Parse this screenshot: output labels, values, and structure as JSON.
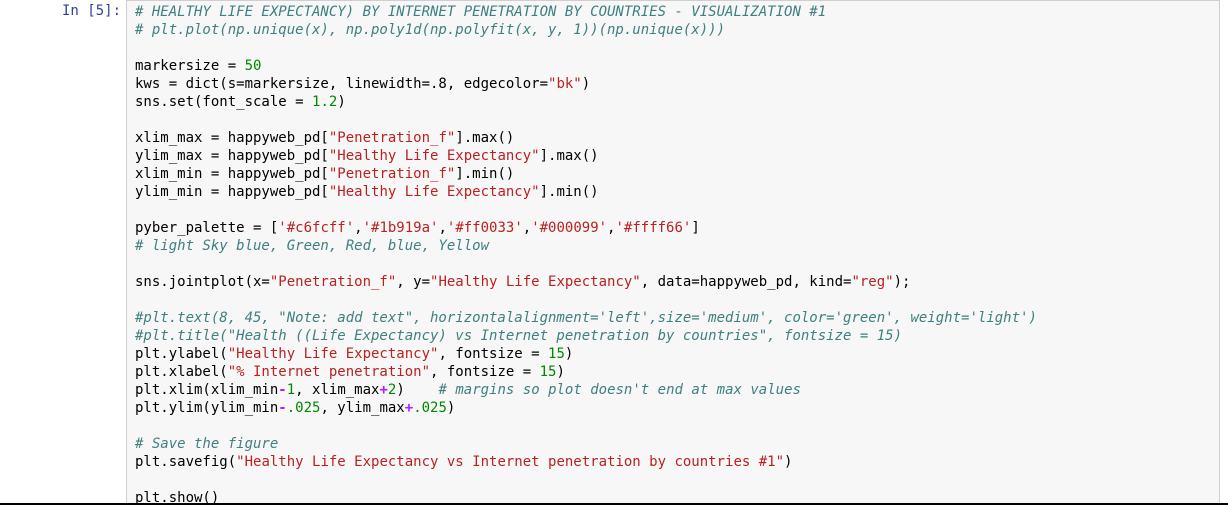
{
  "cell": {
    "prompt": "In [5]:",
    "lines": [
      [
        {
          "t": "c",
          "v": "# HEALTHY LIFE EXPECTANCY) BY INTERNET PENETRATION BY COUNTRIES - VISUALIZATION #1"
        }
      ],
      [
        {
          "t": "c",
          "v": "# plt.plot(np.unique(x), np.poly1d(np.polyfit(x, y, 1))(np.unique(x)))"
        }
      ],
      [],
      [
        {
          "t": "p",
          "v": "markersize = "
        },
        {
          "t": "n",
          "v": "50"
        }
      ],
      [
        {
          "t": "p",
          "v": "kws = dict(s=markersize, linewidth=.8, edgecolor="
        },
        {
          "t": "s",
          "v": "\"bk\""
        },
        {
          "t": "p",
          "v": ")"
        }
      ],
      [
        {
          "t": "p",
          "v": "sns.set(font_scale = "
        },
        {
          "t": "n",
          "v": "1.2"
        },
        {
          "t": "p",
          "v": ")"
        }
      ],
      [],
      [
        {
          "t": "p",
          "v": "xlim_max = happyweb_pd["
        },
        {
          "t": "s",
          "v": "\"Penetration_f\""
        },
        {
          "t": "p",
          "v": "].max()"
        }
      ],
      [
        {
          "t": "p",
          "v": "ylim_max = happyweb_pd["
        },
        {
          "t": "s",
          "v": "\"Healthy Life Expectancy\""
        },
        {
          "t": "p",
          "v": "].max()"
        }
      ],
      [
        {
          "t": "p",
          "v": "xlim_min = happyweb_pd["
        },
        {
          "t": "s",
          "v": "\"Penetration_f\""
        },
        {
          "t": "p",
          "v": "].min()"
        }
      ],
      [
        {
          "t": "p",
          "v": "ylim_min = happyweb_pd["
        },
        {
          "t": "s",
          "v": "\"Healthy Life Expectancy\""
        },
        {
          "t": "p",
          "v": "].min()"
        }
      ],
      [],
      [
        {
          "t": "p",
          "v": "pyber_palette = ["
        },
        {
          "t": "s",
          "v": "'#c6fcff'"
        },
        {
          "t": "p",
          "v": ","
        },
        {
          "t": "s",
          "v": "'#1b919a'"
        },
        {
          "t": "p",
          "v": ","
        },
        {
          "t": "s",
          "v": "'#ff0033'"
        },
        {
          "t": "p",
          "v": ","
        },
        {
          "t": "s",
          "v": "'#000099'"
        },
        {
          "t": "p",
          "v": ","
        },
        {
          "t": "s",
          "v": "'#ffff66'"
        },
        {
          "t": "p",
          "v": "]"
        }
      ],
      [
        {
          "t": "c",
          "v": "# light Sky blue, Green, Red, blue, Yellow"
        }
      ],
      [],
      [
        {
          "t": "p",
          "v": "sns.jointplot(x="
        },
        {
          "t": "s",
          "v": "\"Penetration_f\""
        },
        {
          "t": "p",
          "v": ", y="
        },
        {
          "t": "s",
          "v": "\"Healthy Life Expectancy\""
        },
        {
          "t": "p",
          "v": ", data=happyweb_pd, kind="
        },
        {
          "t": "s",
          "v": "\"reg\""
        },
        {
          "t": "p",
          "v": ");"
        }
      ],
      [],
      [
        {
          "t": "c",
          "v": "#plt.text(8, 45, \"Note: add text\", horizontalalignment='left',size='medium', color='green', weight='light')"
        }
      ],
      [
        {
          "t": "c",
          "v": "#plt.title(\"Health ((Life Expectancy) vs Internet penetration by countries\", fontsize = 15)"
        }
      ],
      [
        {
          "t": "p",
          "v": "plt.ylabel("
        },
        {
          "t": "s",
          "v": "\"Healthy Life Expectancy\""
        },
        {
          "t": "p",
          "v": ", fontsize = "
        },
        {
          "t": "n",
          "v": "15"
        },
        {
          "t": "p",
          "v": ")"
        }
      ],
      [
        {
          "t": "p",
          "v": "plt.xlabel("
        },
        {
          "t": "s",
          "v": "\"% Internet penetration\""
        },
        {
          "t": "p",
          "v": ", fontsize = "
        },
        {
          "t": "n",
          "v": "15"
        },
        {
          "t": "p",
          "v": ")"
        }
      ],
      [
        {
          "t": "p",
          "v": "plt.xlim(xlim_min"
        },
        {
          "t": "o",
          "v": "-"
        },
        {
          "t": "n",
          "v": "1"
        },
        {
          "t": "p",
          "v": ", xlim_max"
        },
        {
          "t": "o",
          "v": "+"
        },
        {
          "t": "n",
          "v": "2"
        },
        {
          "t": "p",
          "v": ")    "
        },
        {
          "t": "c",
          "v": "# margins so plot doesn't end at max values"
        }
      ],
      [
        {
          "t": "p",
          "v": "plt.ylim(ylim_min"
        },
        {
          "t": "o",
          "v": "-"
        },
        {
          "t": "n",
          "v": ".025"
        },
        {
          "t": "p",
          "v": ", ylim_max"
        },
        {
          "t": "o",
          "v": "+"
        },
        {
          "t": "n",
          "v": ".025"
        },
        {
          "t": "p",
          "v": ")"
        }
      ],
      [],
      [
        {
          "t": "c",
          "v": "# Save the figure"
        }
      ],
      [
        {
          "t": "p",
          "v": "plt.savefig("
        },
        {
          "t": "s",
          "v": "\"Healthy Life Expectancy vs Internet penetration by countries #1\""
        },
        {
          "t": "p",
          "v": ")"
        }
      ],
      [],
      [
        {
          "t": "p",
          "v": "plt.show()"
        }
      ]
    ]
  },
  "colors": {
    "prompt": "#303f9f",
    "comment": "#408080",
    "string": "#ba2121",
    "number": "#008800",
    "operator": "#aa22ff",
    "cell_background": "#f7f7f7",
    "cell_border": "#cfcfcf"
  }
}
